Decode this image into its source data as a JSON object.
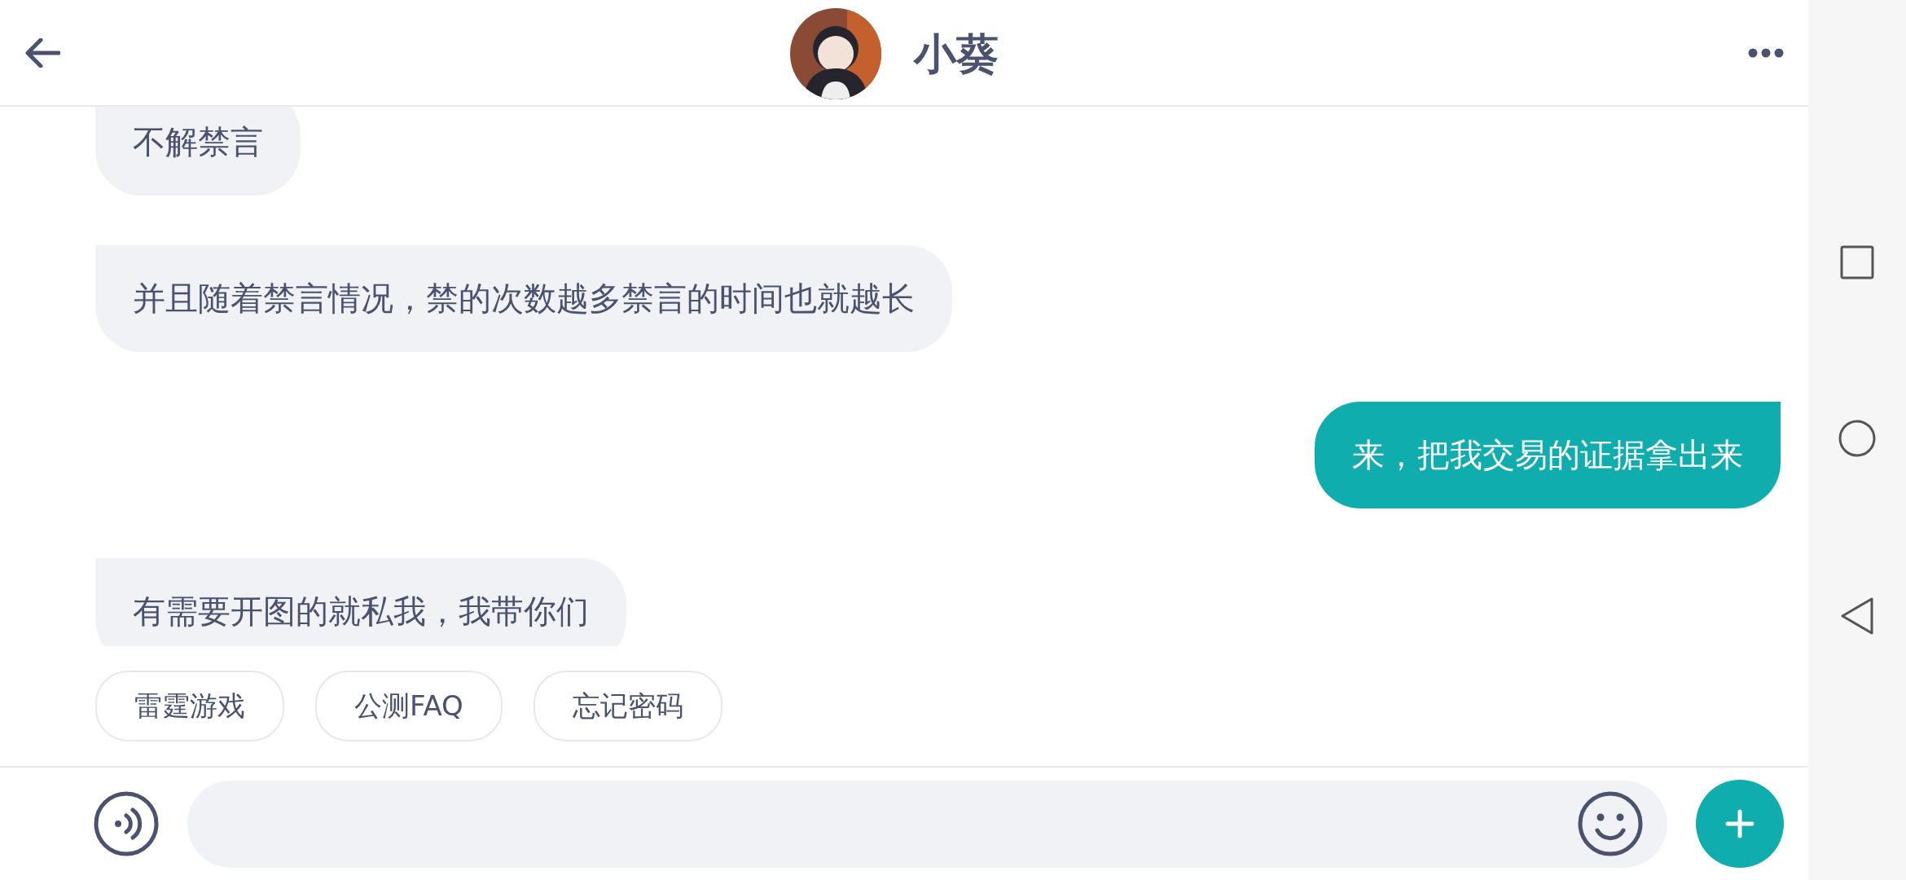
{
  "header": {
    "title": "小葵"
  },
  "messages": [
    {
      "kind": "received",
      "text": "不解禁言"
    },
    {
      "kind": "received",
      "text": "并且随着禁言情况，禁的次数越多禁言的时间也就越长"
    },
    {
      "kind": "sent",
      "text": "来，把我交易的证据拿出来"
    },
    {
      "kind": "received",
      "text": "有需要开图的就私我，我带你们"
    }
  ],
  "quick_replies": [
    "雷霆游戏",
    "公测FAQ",
    "忘记密码"
  ]
}
